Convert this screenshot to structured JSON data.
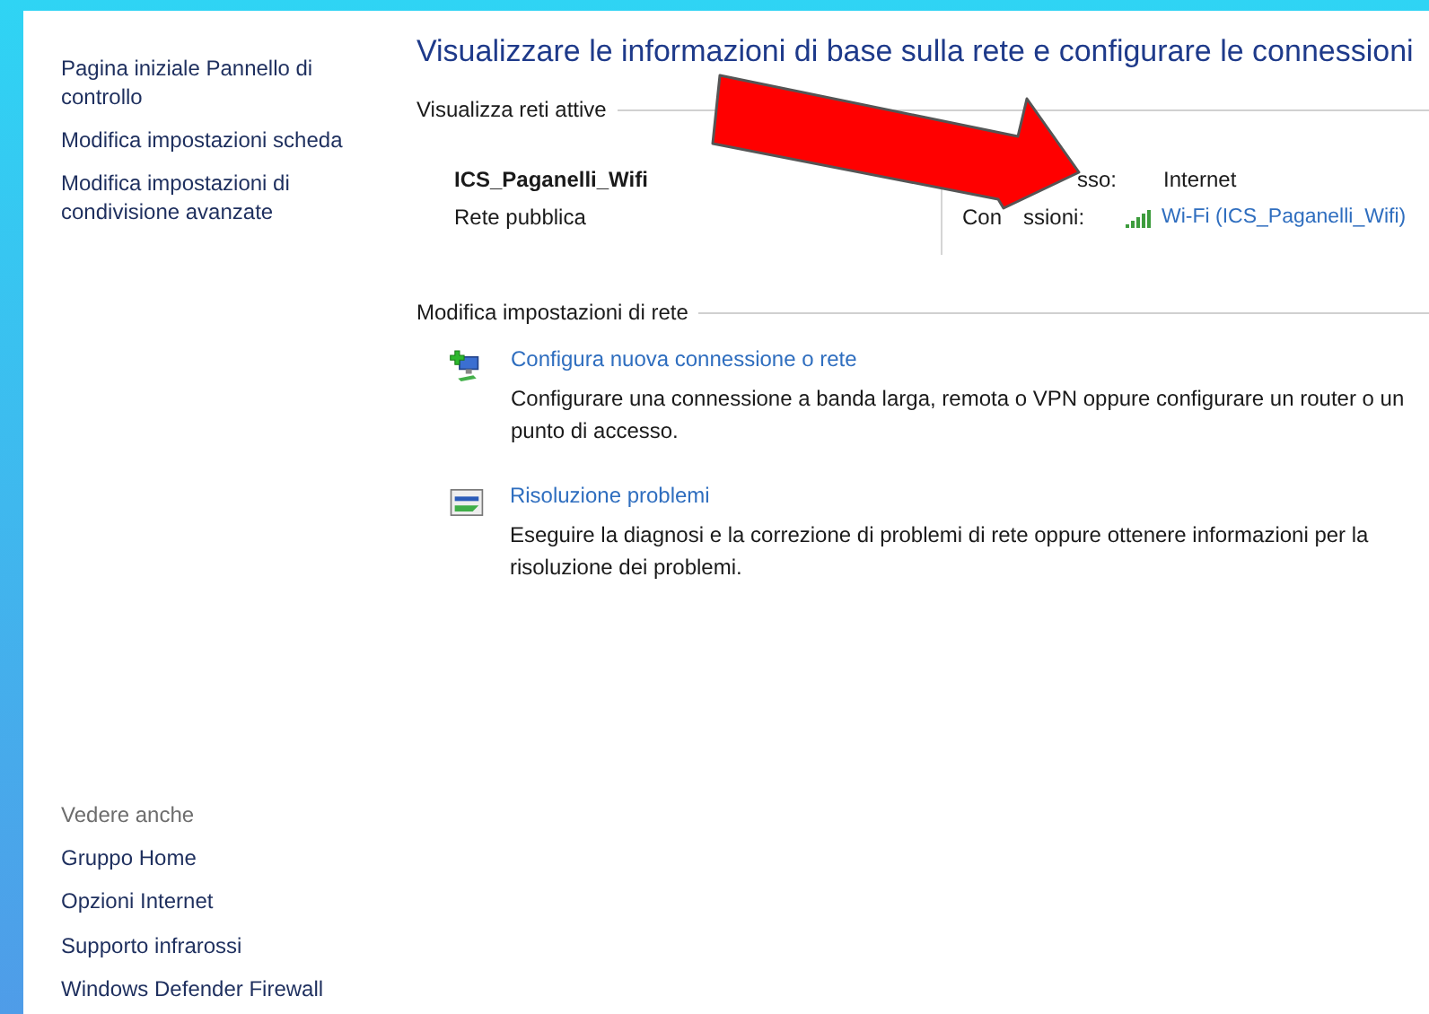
{
  "sidebar": {
    "links": [
      "Pagina iniziale Pannello di controllo",
      "Modifica impostazioni scheda",
      "Modifica impostazioni di condivisione avanzate"
    ],
    "see_also": {
      "title": "Vedere anche",
      "links": [
        "Gruppo Home",
        "Opzioni Internet",
        "Supporto infrarossi",
        "Windows Defender Firewall"
      ]
    }
  },
  "main": {
    "title": "Visualizzare le informazioni di base sulla rete e configurare le connessioni",
    "active_networks": {
      "heading": "Visualizza reti attive",
      "name": "ICS_Paganelli_Wifi",
      "type": "Rete pubblica",
      "access_label": "sso:",
      "access_value": "Internet",
      "connections_label_parts": [
        "Con",
        "ssioni:"
      ],
      "connection_link": "Wi-Fi (ICS_Paganelli_Wifi)"
    },
    "settings": {
      "heading": "Modifica impostazioni di rete",
      "tasks": [
        {
          "kind": "new-connection",
          "link": "Configura nuova connessione o rete",
          "description": "Configurare una connessione a banda larga, remota o VPN oppure configurare un router o un punto di accesso."
        },
        {
          "kind": "troubleshoot",
          "link": "Risoluzione problemi",
          "description": "Eseguire la diagnosi e la correzione di problemi di rete oppure ottenere informazioni per la risoluzione dei problemi."
        }
      ]
    }
  }
}
